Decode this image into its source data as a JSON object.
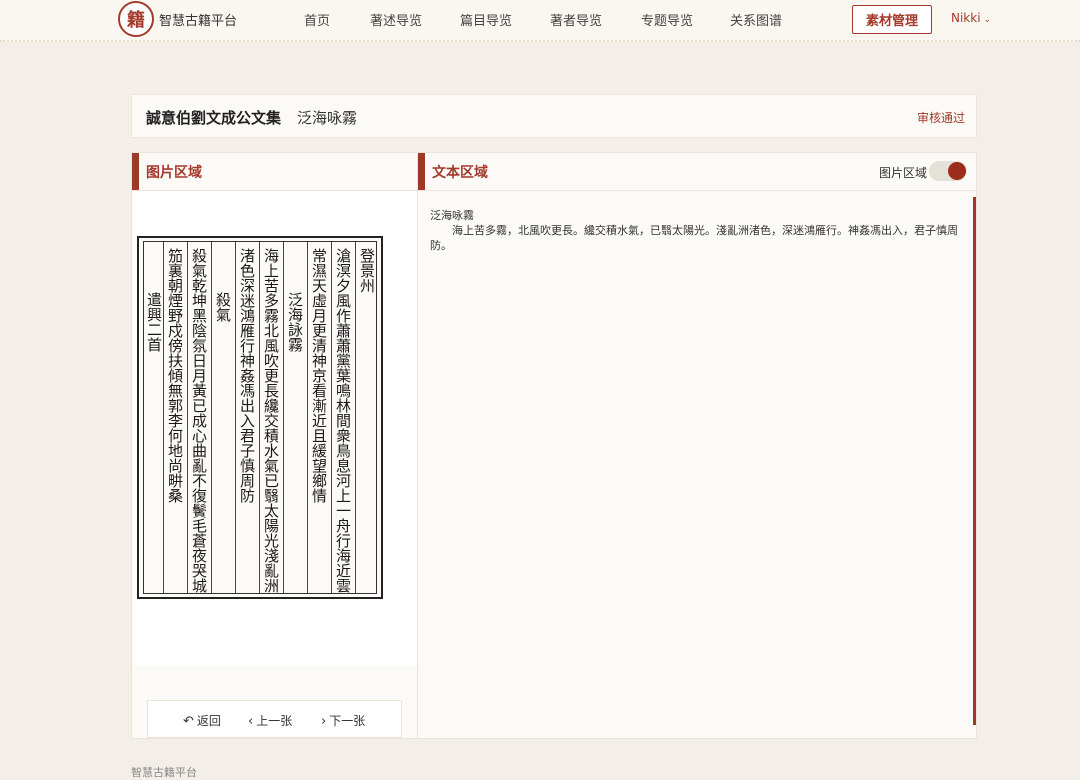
{
  "header": {
    "logo_char": "籍",
    "site_name": "智慧古籍平台",
    "nav": [
      "首页",
      "著述导览",
      "篇目导览",
      "著者导览",
      "专题导览",
      "关系图谱"
    ],
    "manage_button": "素材管理",
    "user": "Nikki"
  },
  "doc": {
    "book_title": "誠意伯劉文成公文集",
    "title": "泛海咏霧",
    "status": "审核通过"
  },
  "image_panel": {
    "title": "图片区域",
    "scan_columns": [
      "登景州",
      "滄溟夕風作蕭蕭黨葉鳴林間衆鳥息河上一舟行海近雲",
      "常濕天虛月更清神京看漸近且緩望鄉情",
      "泛海詠霧",
      "海上苦多霧北風吹更長纔交積水氣已翳太陽光淺亂洲",
      "渚色深迷鴻雁行神姦馮出入君子慎周防",
      "殺氣",
      "殺氣乾坤黑陰氛日月黃已成心曲亂不復鬢毛蒼夜哭城",
      "笳裏朝煙野戍傍扶傾無郭李何地尚畊桑",
      "遣興二首"
    ],
    "pager": {
      "back": "返回",
      "prev": "上一张",
      "next": "下一张"
    }
  },
  "text_panel": {
    "title": "文本区域",
    "toggle_label": "图片区域",
    "toggle_on": true,
    "content_title": "泛海咏霧",
    "content_body": "海上苦多霧，北風吹更長。纔交積水氣，已翳太陽光。淺亂洲渚色，深迷鴻雁行。神姦馮出入，君子慎周防。"
  },
  "footer": {
    "text": "智慧古籍平台"
  },
  "colors": {
    "accent": "#a33a2c",
    "background": "#f3efe8",
    "panel": "#fcfaf6"
  }
}
